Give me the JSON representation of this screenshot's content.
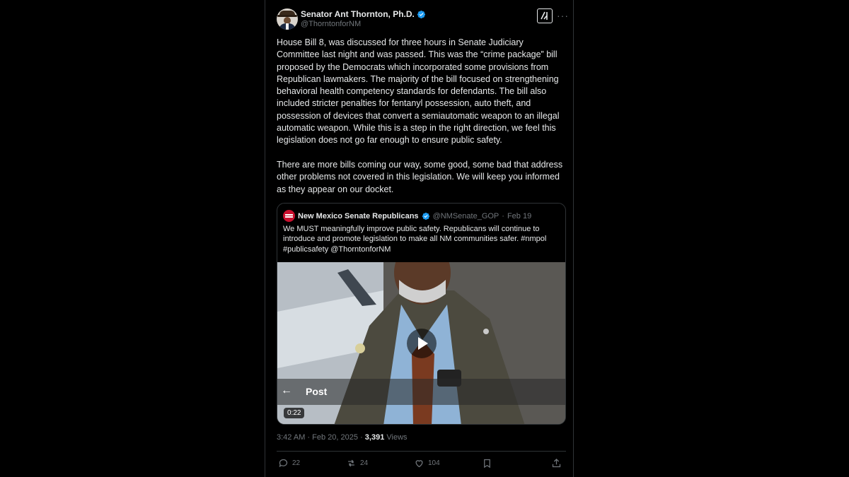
{
  "post": {
    "author_name": "Senator Ant Thornton, Ph.D.",
    "author_handle": "@ThorntonforNM",
    "paragraph_1": "House Bill 8, was discussed for three hours in Senate Judiciary Committee last night and was passed. This was the “crime package” bill proposed by the Democrats which incorporated some provisions from Republican lawmakers.  The majority of the bill focused on strengthening behavioral health competency standards for defendants. The bill also included stricter penalties for fentanyl possession, auto theft, and possession of devices that convert a semiautomatic weapon to an illegal automatic weapon.  While this is a step in the right direction, we feel this legislation does not go far enough to ensure public safety.",
    "paragraph_2": "There are more bills coming our way, some good, some bad that address other problems not covered in this legislation. We will keep you informed as they appear on our docket.",
    "time": "3:42 AM",
    "date": "Feb 20, 2025",
    "views_count": "3,391",
    "views_label": "Views"
  },
  "quote": {
    "author_name": "New Mexico Senate Republicans",
    "author_handle": "@NMSenate_GOP",
    "date": "Feb 19",
    "text": "We MUST meaningfully improve public safety. Republicans will continue to introduce and promote legislation to make all NM communities safer. #nmpol #publicsafety @ThorntonforNM",
    "video": {
      "overlay_title": "Post",
      "duration": "0:22"
    }
  },
  "actions": {
    "replies": "22",
    "reposts": "24",
    "likes": "104"
  },
  "colors": {
    "background": "#000000",
    "text": "#e7e9ea",
    "muted": "#71767b",
    "border": "#2f3336",
    "verified": "#1d9bf0"
  },
  "icons": [
    "verified-badge-icon",
    "grok-icon",
    "more-icon",
    "play-icon",
    "back-arrow-icon",
    "reply-icon",
    "repost-icon",
    "like-icon",
    "bookmark-icon",
    "share-icon"
  ]
}
